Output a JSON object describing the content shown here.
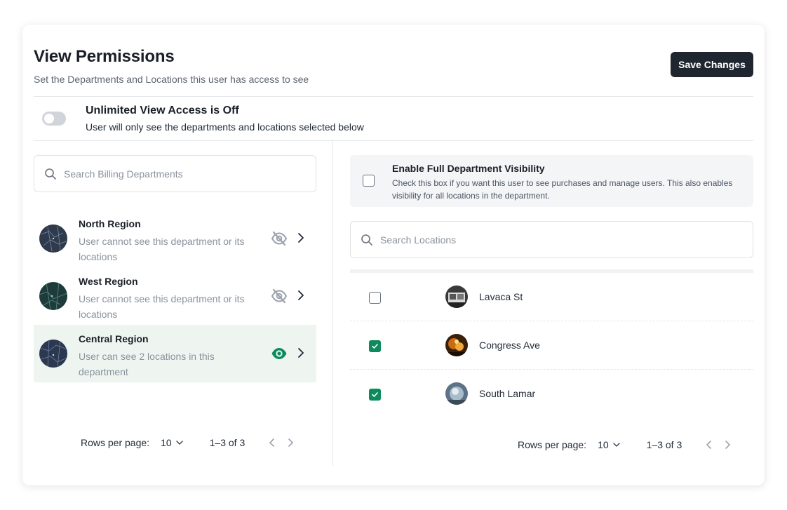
{
  "header": {
    "title": "View Permissions",
    "subtitle": "Set the Departments and Locations this user has access to see",
    "save_label": "Save Changes"
  },
  "unlimited": {
    "title": "Unlimited View Access is Off",
    "subtitle": "User will only see the departments and locations selected below",
    "enabled": false
  },
  "departments": {
    "search_placeholder": "Search Billing Departments",
    "items": [
      {
        "name": "North Region",
        "desc": "User cannot see this department or its locations",
        "visible": false,
        "selected": false
      },
      {
        "name": "West Region",
        "desc": "User cannot see this department or its locations",
        "visible": false,
        "selected": false
      },
      {
        "name": "Central Region",
        "desc": "User can see 2 locations in this department",
        "visible": true,
        "selected": true
      }
    ],
    "pager": {
      "rows_label": "Rows per page:",
      "rows_value": "10",
      "range": "1–3 of 3"
    }
  },
  "full_visibility": {
    "title": "Enable Full Department Visibility",
    "desc": "Check this box if you want this user to see purchases and manage users. This also enables visibility for all locations in the department.",
    "checked": false
  },
  "locations": {
    "search_placeholder": "Search Locations",
    "items": [
      {
        "name": "Lavaca St",
        "checked": false
      },
      {
        "name": "Congress Ave",
        "checked": true
      },
      {
        "name": "South Lamar",
        "checked": true
      }
    ],
    "pager": {
      "rows_label": "Rows per page:",
      "rows_value": "10",
      "range": "1–3 of 3"
    }
  },
  "colors": {
    "accent": "#0e8a5f",
    "primary_button": "#1f2630",
    "selected_row": "#eef5f1"
  }
}
